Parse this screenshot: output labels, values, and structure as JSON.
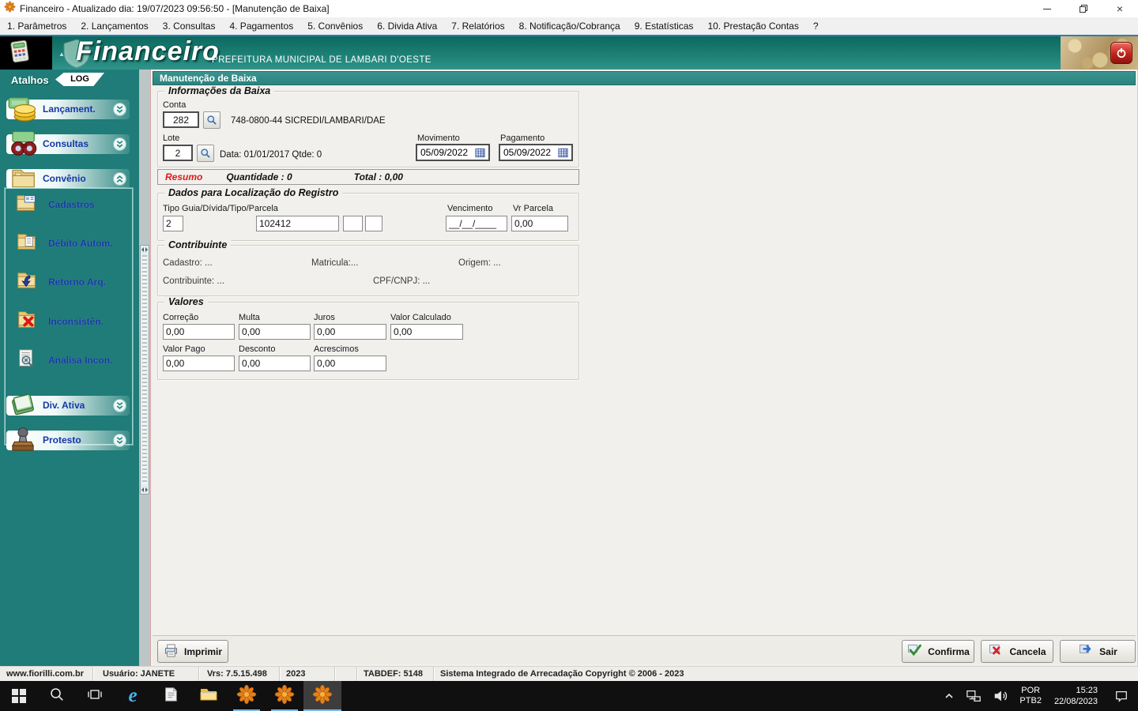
{
  "titlebar": {
    "icon": "app-flower-icon",
    "title": "Financeiro - Atualizado dia: 19/07/2023 09:56:50 - [Manutenção de Baixa]"
  },
  "menubar": {
    "items": [
      "1. Parâmetros",
      "2. Lançamentos",
      "3. Consultas",
      "4. Pagamentos",
      "5. Convênios",
      "6. Divida Ativa",
      "7. Relatórios",
      "8. Notificação/Cobrança",
      "9. Estatísticas",
      "10. Prestação Contas",
      "?"
    ]
  },
  "banner": {
    "logo_text": "Financeiro",
    "subtitle": "PREFEITURA MUNICIPAL DE LAMBARI D'OESTE",
    "icons": [
      "calculator-icon",
      "shield-icon",
      "coins-image",
      "power-button-icon"
    ]
  },
  "sidebar": {
    "header_label": "Atalhos",
    "log_tab": "LOG",
    "groups": [
      {
        "label": "Lançament.",
        "icon": "money-stack-icon",
        "state": "collapsed"
      },
      {
        "label": "Consultas",
        "icon": "binoculars-icon",
        "state": "collapsed"
      },
      {
        "label": "Convênio",
        "icon": "folder-open-icon",
        "state": "expanded"
      },
      {
        "label": "Div. Ativa",
        "icon": "book-icon",
        "state": "collapsed"
      },
      {
        "label": "Protesto",
        "icon": "stamp-icon",
        "state": "collapsed"
      }
    ],
    "convenio_children": [
      {
        "label": "Cadastros",
        "icon": "folder-card-icon"
      },
      {
        "label": "Débito Autom.",
        "icon": "folder-doc-icon"
      },
      {
        "label": "Retorno Arq.",
        "icon": "folder-return-icon"
      },
      {
        "label": "Inconsistên.",
        "icon": "folder-error-icon"
      },
      {
        "label": "Analisa Incon.",
        "icon": "doc-magnifier-icon"
      }
    ]
  },
  "main": {
    "title": "Manutenção de Baixa",
    "info": {
      "legend": "Informações da Baixa",
      "conta_label": "Conta",
      "conta_value": "282",
      "conta_desc": "748-0800-44 SICREDI/LAMBARI/DAE",
      "lote_label": "Lote",
      "lote_value": "2",
      "lote_desc": "Data: 01/01/2017 Qtde: 0",
      "movimento_label": "Movimento",
      "movimento_value": "05/09/2022",
      "pagamento_label": "Pagamento",
      "pagamento_value": "05/09/2022"
    },
    "resumo": {
      "label": "Resumo",
      "quantidade": "Quantidade : 0",
      "total": "Total : 0,00"
    },
    "localizacao": {
      "legend": "Dados para Localização do Registro",
      "tipo_label": "Tipo Guia/Dívida/Tipo/Parcela",
      "tipo_value": "2",
      "guia_value": "102412",
      "extra1_value": "",
      "extra2_value": "",
      "vencimento_label": "Vencimento",
      "vencimento_value": "__/__/____",
      "parcela_label": "Vr Parcela",
      "parcela_value": "0,00"
    },
    "contribuinte": {
      "legend": "Contribuinte",
      "cadastro": "Cadastro: ...",
      "matricula": "Matricula:...",
      "origem": "Origem: ...",
      "contribuinte": "Contribuinte: ...",
      "cpf": "CPF/CNPJ: ..."
    },
    "valores": {
      "legend": "Valores",
      "row1": [
        {
          "label": "Correção",
          "value": "0,00"
        },
        {
          "label": "Multa",
          "value": "0,00"
        },
        {
          "label": "Juros",
          "value": "0,00"
        },
        {
          "label": "Valor Calculado",
          "value": "0,00"
        }
      ],
      "row2": [
        {
          "label": "Valor Pago",
          "value": "0,00"
        },
        {
          "label": "Desconto",
          "value": "0,00"
        },
        {
          "label": "Acrescimos",
          "value": "0,00"
        }
      ]
    },
    "buttons": {
      "imprimir": "Imprimir",
      "confirma": "Confirma",
      "cancela": "Cancela",
      "sair": "Sair"
    }
  },
  "statusbar": {
    "website": "www.fiorilli.com.br",
    "user": "Usuário: JANETE",
    "version": "Vrs: 7.5.15.498",
    "year": "2023",
    "tabdef": "TABDEF: 5148",
    "copyright": "Sistema Integrado de Arrecadação Copyright © 2006 - 2023"
  },
  "taskbar": {
    "language_top": "POR",
    "language_bottom": "PTB2",
    "time": "15:23",
    "date": "22/08/2023",
    "icons": [
      "start-icon",
      "search-icon",
      "task-view-icon",
      "internet-explorer-icon",
      "notepad-icon",
      "file-explorer-icon",
      "fiorilli-app-icon",
      "fiorilli-app-icon",
      "fiorilli-app-icon",
      "tray-chevron-icon",
      "network-icon",
      "speaker-icon",
      "notification-icon"
    ]
  },
  "colors": {
    "teal_banner": "#1d7f75",
    "teal_sidebar": "#1f7c78",
    "sidebar_link_blue": "#1636a8",
    "resumo_red": "#e01818",
    "taskbar_underline": "#76b9ed",
    "app_orange": "#e4801c"
  }
}
